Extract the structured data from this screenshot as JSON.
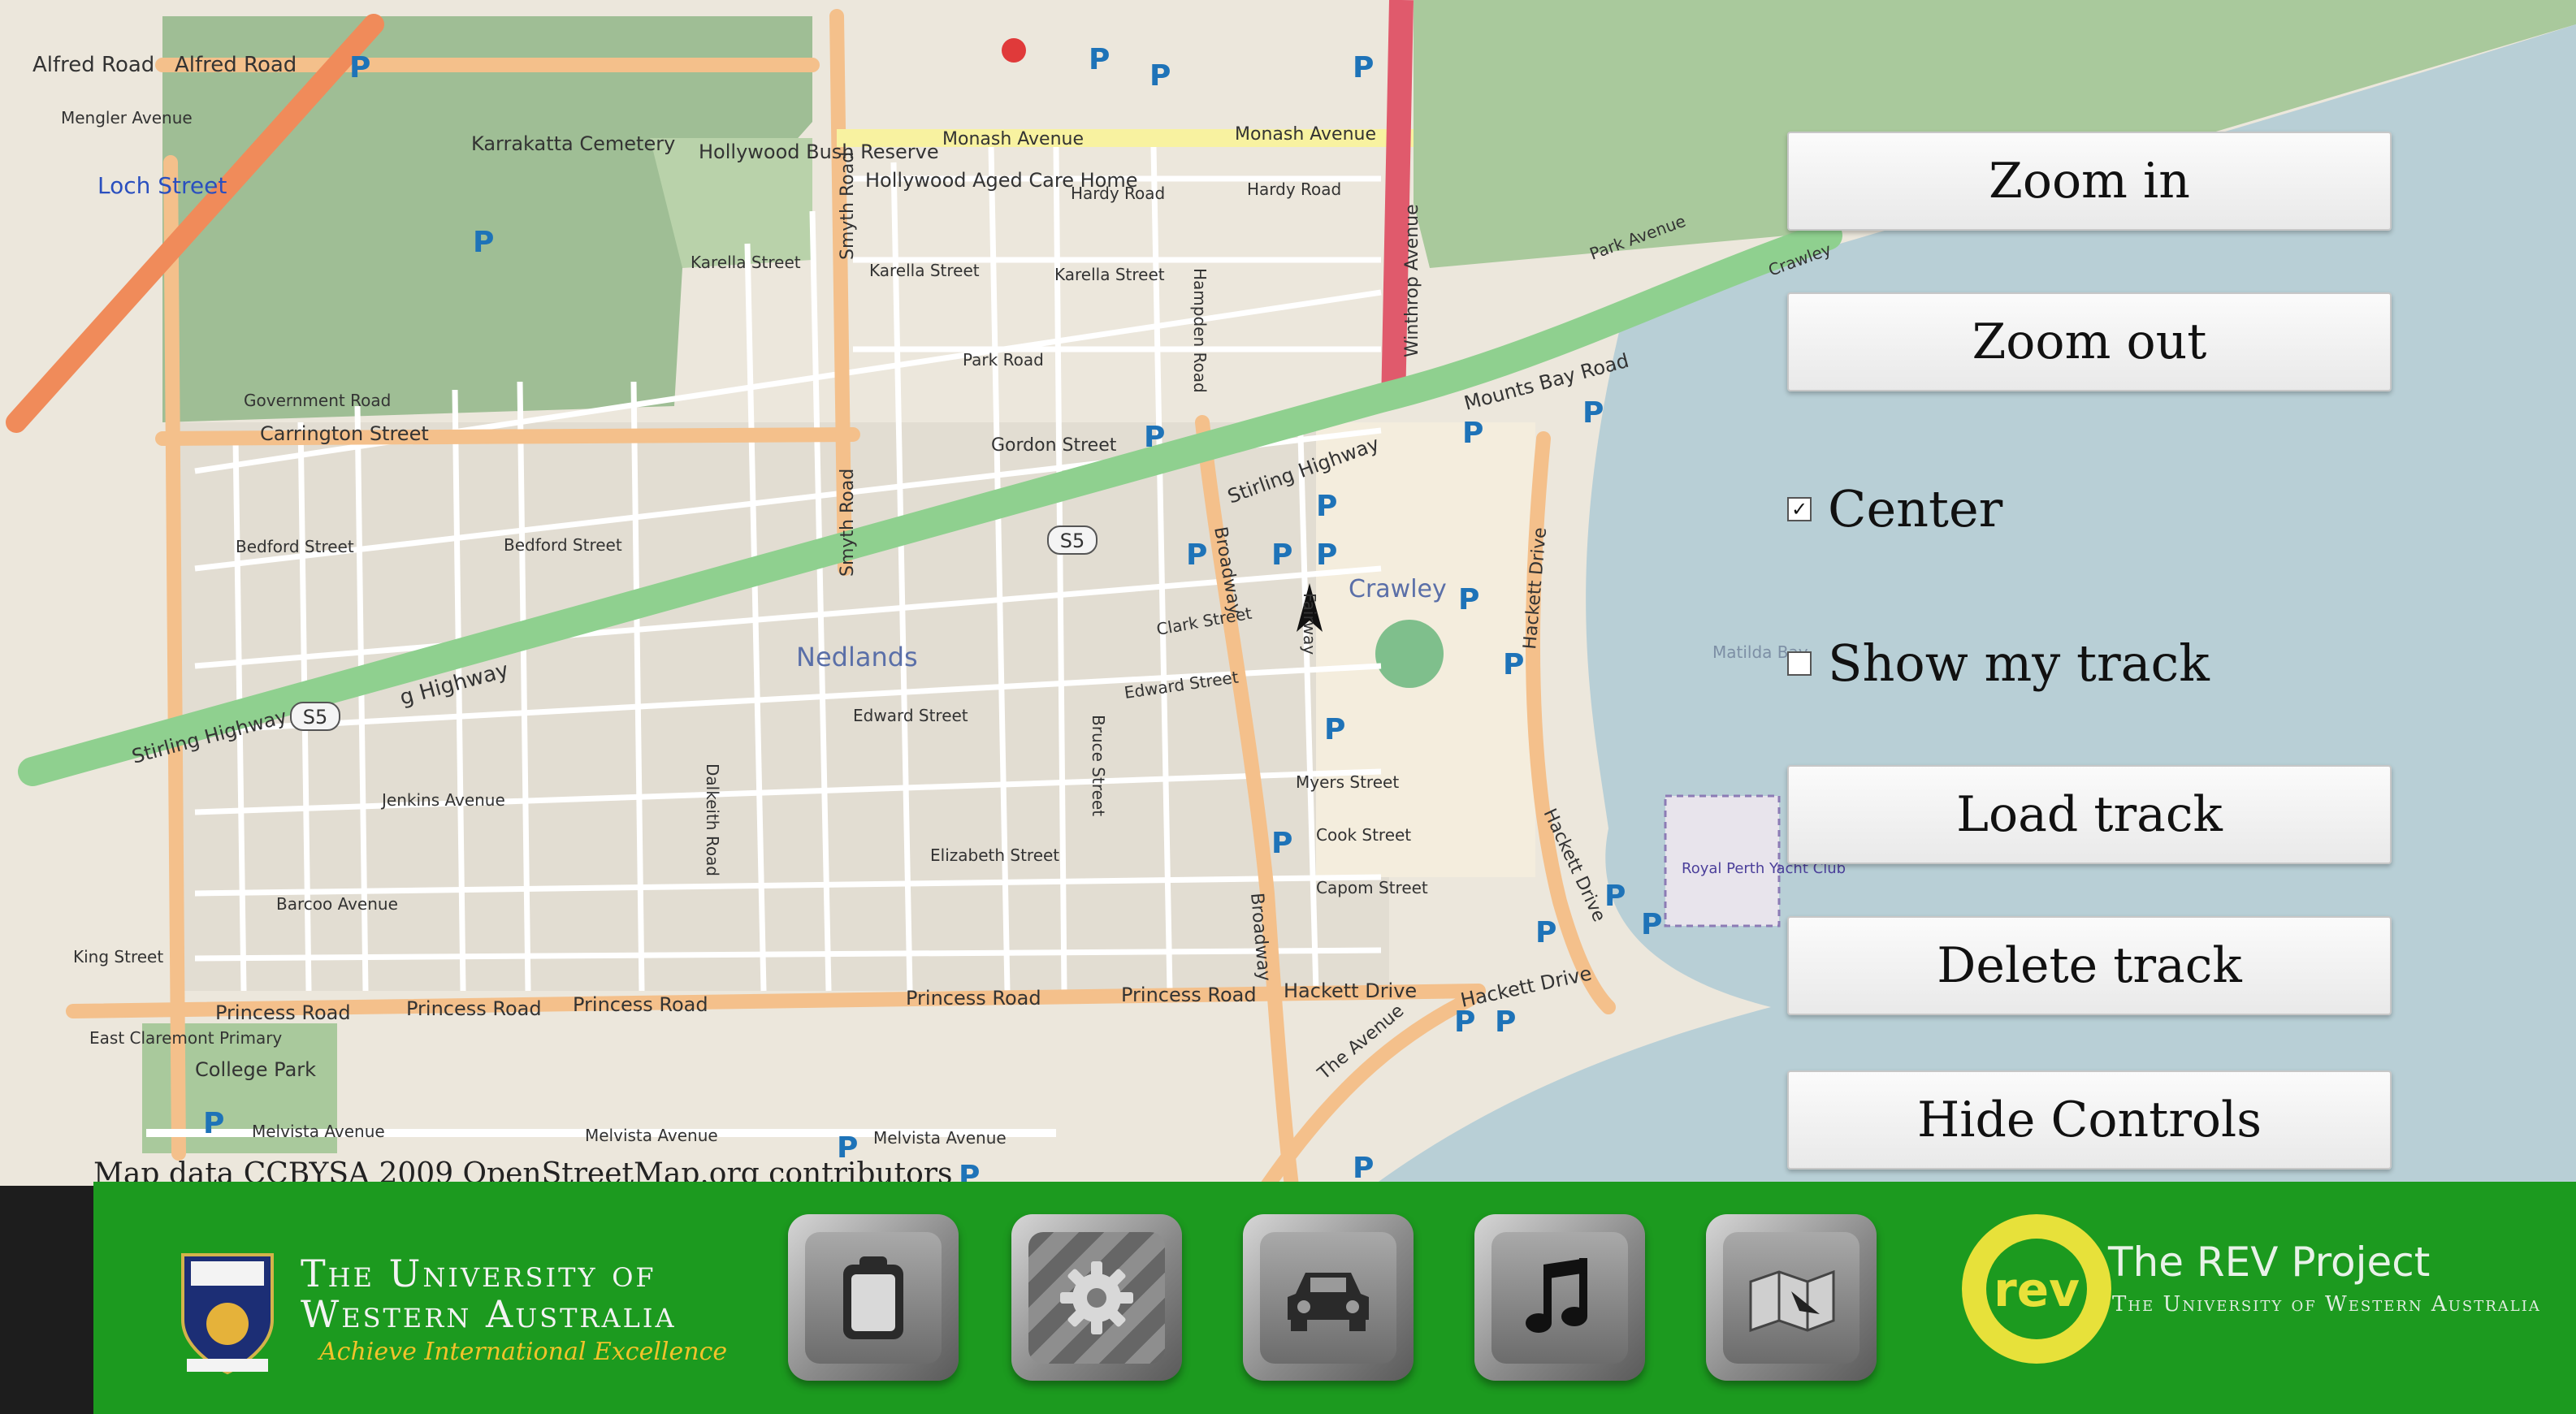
{
  "map": {
    "attribution": "Map data CCBYSA 2009 OpenStreetMap.org contributors",
    "labels": {
      "alfred_road_1": "Alfred Road",
      "alfred_road_2": "Alfred Road",
      "mengler": "Mengler Avenue",
      "loch_street": "Loch Street",
      "karrakatta": "Karrakatta Cemetery",
      "hollywood_bush": "Hollywood Bush Reserve",
      "hollywood_care": "Hollywood Aged Care Home",
      "monash_1": "Monash Avenue",
      "monash_2": "Monash Avenue",
      "hardy_1": "Hardy Road",
      "hardy_2": "Hardy Road",
      "karella_1": "Karella Street",
      "karella_2": "Karella Street",
      "karella_3": "Karella Street",
      "park_road": "Park Road",
      "gordon": "Gordon Street",
      "carrington": "Carrington Street",
      "government": "Government Road",
      "bedford_1": "Bedford Street",
      "bedford_2": "Bedford Street",
      "stirling_1": "Stirling Highway",
      "stirling_2": "g Highway",
      "stirling_3": "Stirling Highway",
      "mounts_bay": "Mounts Bay Road",
      "nedlands": "Nedlands",
      "crawley": "Crawley",
      "edward_1": "Edward Street",
      "edward_2": "Edward Street",
      "clark": "Clark Street",
      "jenkins": "Jenkins Avenue",
      "barcoo": "Barcoo Avenue",
      "elizabeth": "Elizabeth Street",
      "myers": "Myers Street",
      "cook": "Cook Street",
      "capom": "Capom Street",
      "princess_1": "Princess Road",
      "princess_2": "Princess Road",
      "princess_3": "Princess Road",
      "princess_4": "Princess Road",
      "princess_5": "Princess Road",
      "hackett_1": "Hackett Drive",
      "hackett_2": "Hackett Drive",
      "hackett_3": "Hackett Drive",
      "hackett_4": "Hackett Drive",
      "the_avenue": "The Avenue",
      "melvista_1": "Melvista Avenue",
      "melvista_2": "Melvista Avenue",
      "melvista_3": "Melvista Avenue",
      "college_park": "College Park",
      "claremont_primary": "East Claremont Primary",
      "matilda_bay": "Matilda Bay",
      "royal_perth": "Royal Perth Yacht Club",
      "king_street": "King Street",
      "broadway_1": "Broadway",
      "broadway_2": "Broadway",
      "smyth_1": "Smyth Road",
      "smyth_2": "Smyth Road",
      "winthrop": "Winthrop Avenue",
      "park_avenue": "Park Avenue",
      "crawley_top": "Crawley",
      "hampden": "Hampden Road",
      "dalkeith": "Dalkeith Road",
      "bruce": "Bruce Street",
      "fairway": "Fairway",
      "route": "S5"
    }
  },
  "controls": {
    "zoom_in": "Zoom in",
    "zoom_out": "Zoom out",
    "center_label": "Center",
    "center_checked": true,
    "show_track_label": "Show my track",
    "show_track_checked": false,
    "load_track": "Load track",
    "delete_track": "Delete track",
    "hide_controls": "Hide Controls"
  },
  "footer": {
    "university_line1": "The University of",
    "university_line2": "Western Australia",
    "motto": "Achieve International Excellence",
    "rev_title": "The REV Project",
    "rev_subtitle": "The University of Western Australia",
    "rev_badge": "rev",
    "apps": [
      {
        "name": "clipboard-icon"
      },
      {
        "name": "gear-icon"
      },
      {
        "name": "car-icon"
      },
      {
        "name": "music-note-icon"
      },
      {
        "name": "map-icon"
      }
    ]
  },
  "colors": {
    "bar_green": "#1c9a1f",
    "park_green": "#8fb784",
    "water": "#b8cfd6",
    "highway": "#8fd08f",
    "arterial": "#f4c08b"
  }
}
